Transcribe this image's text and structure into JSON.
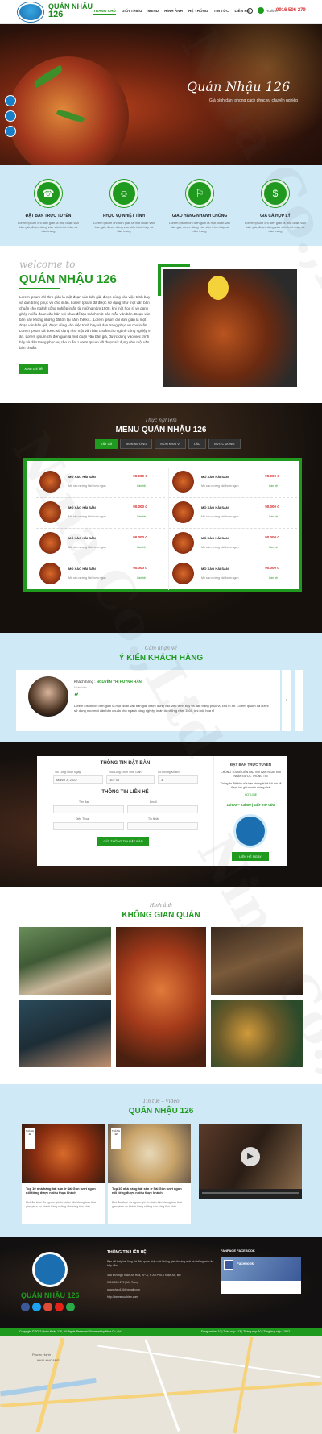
{
  "header": {
    "logo_line1": "QUÁN NHẬU",
    "logo_line2": "126",
    "nav": [
      "TRANG CHỦ",
      "GIỚI THIỆU",
      "MENU",
      "HÌNH ẢNH",
      "HỆ THỐNG",
      "TIN TỨC",
      "LIÊN HỆ"
    ],
    "hotline_label": "Hotline:",
    "hotline_number": "0916 506 279"
  },
  "hero": {
    "title": "Quán Nhậu 126",
    "subtitle": "Giá bình dân, phong cách phục vụ chuyên nghiệp"
  },
  "features": [
    {
      "title": "ĐẶT BÀN TRỰC TUYẾN",
      "desc": "Lorem ipsum chỉ đơn giản là một đoạn văn bản giả, được dùng vào việc trình bày và dàn trang"
    },
    {
      "title": "PHỤC VỤ NHIỆT TÌNH",
      "desc": "Lorem ipsum chỉ đơn giản là một đoạn văn bản giả, được dùng vào việc trình bày và dàn trang"
    },
    {
      "title": "GIAO HÀNG NHANH CHÓNG",
      "desc": "Lorem ipsum chỉ đơn giản là một đoạn văn bản giả, được dùng vào việc trình bày và dàn trang"
    },
    {
      "title": "GIÁ CẢ HỢP LÝ",
      "desc": "Lorem ipsum chỉ đơn giản là một đoạn văn bản giả, được dùng vào việc trình bày và dàn trang"
    }
  ],
  "welcome": {
    "script": "welcome to",
    "title": "QUÁN NHẬU 126",
    "text": "Lorem ipsum chỉ đơn giản là một đoạn văn bản giả, được dùng vào việc trình bày và dàn trang phục vụ cho in ấn. Lorem Ipsum đã được sử dụng như một văn bản chuẩn cho ngành công nghiệp in ấn từ những năm 1500, khi một họa sĩ vô danh ghép nhiều đoạn văn bản với nhau để tạo thành một bản mẫu văn bản. Đoạn văn bản này không những đã tồn tại năm thế kỉ,... Lorem ipsum chỉ đơn giản là một đoạn văn bản giả, được dùng vào việc trình bày và dàn trang phục vụ cho in ấn. Lorem Ipsum đã được sử dụng như một văn bản chuẩn cho ngành công nghiệp in ấn. Lorem ipsum chỉ đơn giản là một đoạn văn bản giả, được dùng vào việc trình bày và dàn trang phục vụ cho in ấn. Lorem Ipsum đã được sử dụng như một văn bản chuẩn.",
    "button": "Xem chi tiết"
  },
  "menu": {
    "script": "Thực nghiệm",
    "title": "MENU QUÁN NHẬU 126",
    "tabs": [
      "TẤT CẢ",
      "MÓN NƯỚNG",
      "MÓN KHAI VỊ",
      "LẨU",
      "NƯỚC UỐNG"
    ],
    "item_name": "MÓ XÀO HẢI SẢN",
    "item_desc": "Mô xào nướng hải thơm ngon",
    "item_price": "90.000 đ",
    "item_more": "Lần hệ"
  },
  "testimonial": {
    "script": "Cảm nhận về",
    "title": "Ý KIẾN KHÁCH HÀNG",
    "name_label": "Khách hàng :",
    "name": "NGUYỄN THỊ HUỲNH HÂN",
    "role": "Nhân viên",
    "quote": "“",
    "text": "Lorem ipsum chỉ đơn giản là một đoạn văn bản giả, được dùng vào việc trình bày và dàn trang phục vụ cho in ấn. Lorem Ipsum đã được sử dụng như một văn bản chuẩn cho ngành công nghiệp in ấn từ những năm 1500, khi một họa sĩ"
  },
  "booking": {
    "title1": "THÔNG TIN ĐẶT BÀN",
    "label_date": "Vui Lòng Chọn Ngày",
    "date_value": "March 3, 2022",
    "label_time": "Vui Lòng Chọn Thời Gian",
    "time_value": "10 : 00",
    "label_guests": "Số Lượng Khách",
    "guests_value": "3",
    "title2": "THÔNG TIN LIÊN HỆ",
    "label_name": "Tên Bạn",
    "label_email": "Email",
    "label_phone": "Điện Thoại",
    "label_message": "Tin Nhắn",
    "submit": "GỬI THÔNG TIN ĐẶT BÀN",
    "right_title": "ĐẶT BÀN TRỰC TUYẾN",
    "right_line1": "CHÚNG TÔI SẼ LIÊN LẠC VỚI BẠN NGAY KHI NHẬN ĐƯỢC THÔNG TIN",
    "right_line2": "Thông tin đặt bàn của bạn không bị bê bối mà sẽ được lưu giữ nhanh chóng nhất",
    "right_line3": "HOTLINE",
    "hours": "11h00 – 23h00 | Giờ mở cửa",
    "contact": "LIÊN HỆ NGAY"
  },
  "space": {
    "script": "Hình ảnh",
    "title": "KHÔNG GIAN QUÁN"
  },
  "news": {
    "script": "Tin tức – Video",
    "title": "QUÁN NHẬU 126",
    "date_month": "THÁNG",
    "date_day": "12",
    "posts": [
      {
        "title": "Top 10 nhà hàng hải sản ở Sài Gòn tươi ngon nổi tiếng được nhiều thực khách",
        "desc": "Phố ẩm thực đa nguồn gốc từ nhiều tiệc khung hơn thời gian phục vụ khách hàng những căn sống tiền nhất"
      },
      {
        "title": "Top 10 nhà hàng hải sản ở Sài Gòn tươi ngon nổi tiếng được nhiều thực khách",
        "desc": "Phố ẩm thực đa nguồn gốc từ nhiều tiệc khung hơn thời gian phục vụ khách hàng những căn sống tiền nhất"
      }
    ]
  },
  "footer": {
    "brand": "QUÁN NHẬU 126",
    "info_title": "THÔNG TIN LIÊN HỆ",
    "info_text": "Bạn sẽ thấy hài lòng khi đến quán nhậu với không gian thoáng mát và những món ăn hấp dẫn",
    "address": "438 Đường Thuận An Hòa, KP A, P. An Phú, Thuận An, BD",
    "phone": "0916 506 279 | Mr. Trung",
    "email": "quannhau126@gmail.com",
    "website": "http://tomnecuabien.com",
    "fb_title": "FANPAGE FACEBOOK",
    "fb_page": "Facebook",
    "copyright": "Copyright © 2022 Quán Nhậu 126, All Rights Reserved. Powered by Nina Co.,Ltd",
    "counter": "Đang online: 10  |  Tuần này: 113  |  Tháng này: 10  |  Tổng truy cập: 11512"
  },
  "map": {
    "place1": "Phước Hạnh",
    "place2": "KHAI KHOANG"
  },
  "colors": {
    "green": "#1f9a1f",
    "blue": "#1b6fb0",
    "red": "#d42a2a",
    "lightblue": "#cfe9f7"
  }
}
